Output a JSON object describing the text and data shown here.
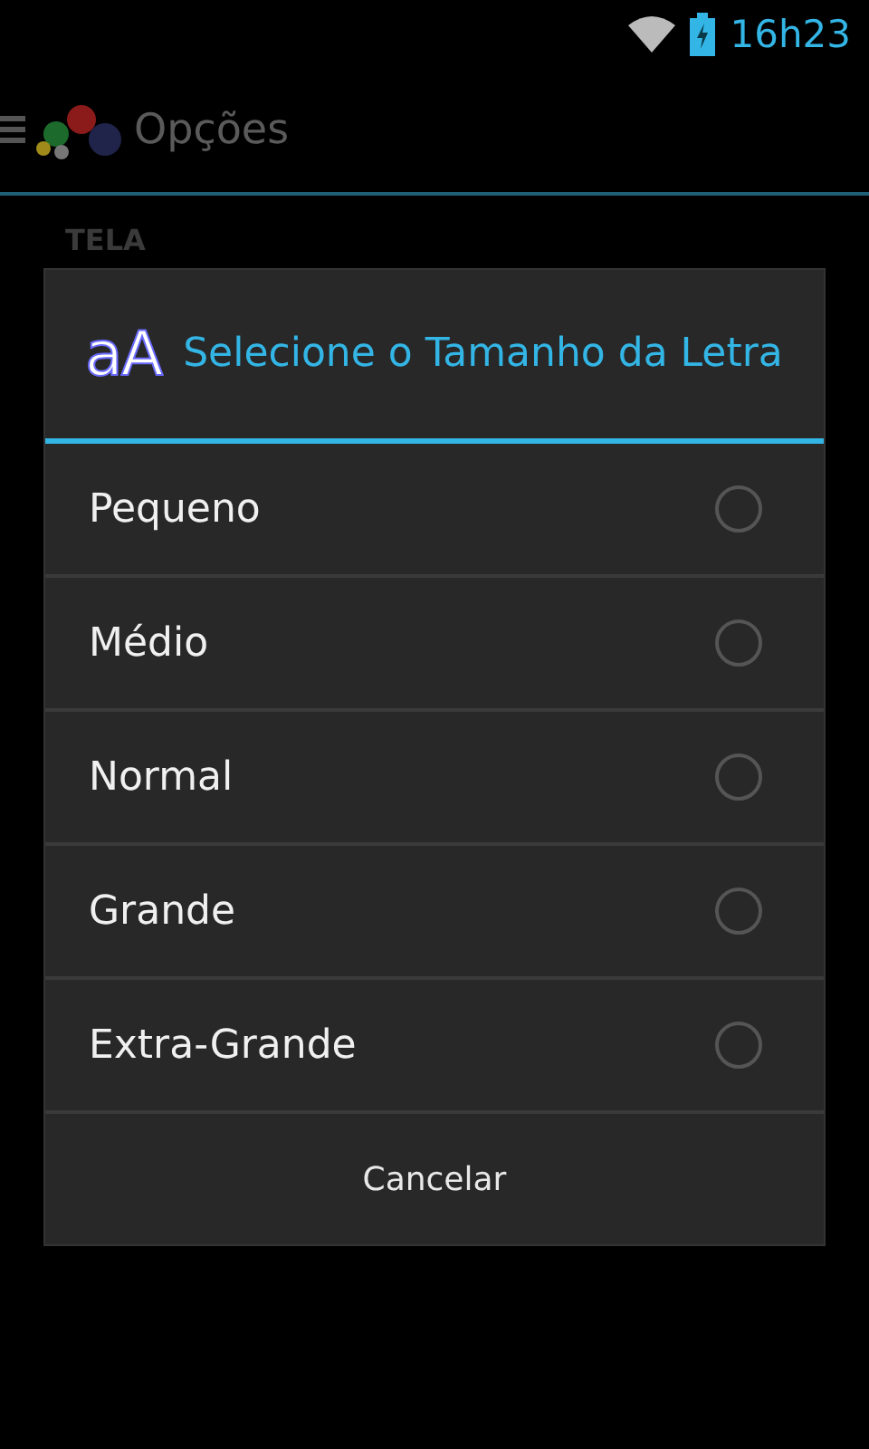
{
  "status_bar": {
    "time": "16h23"
  },
  "action_bar": {
    "title": "Opções"
  },
  "section_header": "TELA",
  "dialog": {
    "icon_text": "aA",
    "title": "Selecione o Tamanho da Letra",
    "options": [
      {
        "label": "Pequeno",
        "selected": false
      },
      {
        "label": "Médio",
        "selected": false
      },
      {
        "label": "Normal",
        "selected": false
      },
      {
        "label": "Grande",
        "selected": false
      },
      {
        "label": "Extra-Grande",
        "selected": false
      }
    ],
    "cancel": "Cancelar"
  }
}
